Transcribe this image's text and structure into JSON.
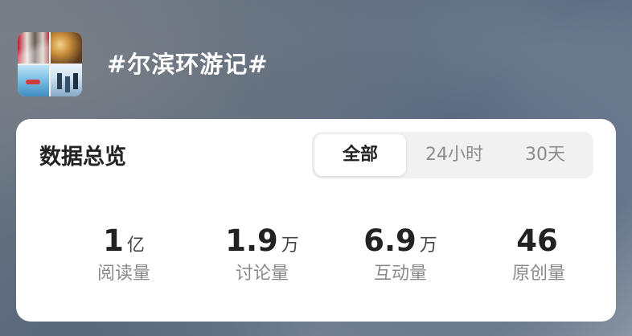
{
  "header": {
    "title": "#尔滨环游记#",
    "thumbnail_icon": "topic-collage-image"
  },
  "overview": {
    "title": "数据总览",
    "tabs": [
      {
        "label": "全部",
        "selected": true
      },
      {
        "label": "24小时",
        "selected": false
      },
      {
        "label": "30天",
        "selected": false
      }
    ],
    "stats": [
      {
        "value": "1",
        "unit": "亿",
        "label": "阅读量"
      },
      {
        "value": "1.9",
        "unit": "万",
        "label": "讨论量"
      },
      {
        "value": "6.9",
        "unit": "万",
        "label": "互动量"
      },
      {
        "value": "46",
        "unit": "",
        "label": "原创量"
      }
    ]
  },
  "colors": {
    "card_bg": "#ffffff",
    "primary_text": "#222222",
    "secondary_text": "#8a8a8a",
    "tab_track": "#f1f1f1"
  }
}
